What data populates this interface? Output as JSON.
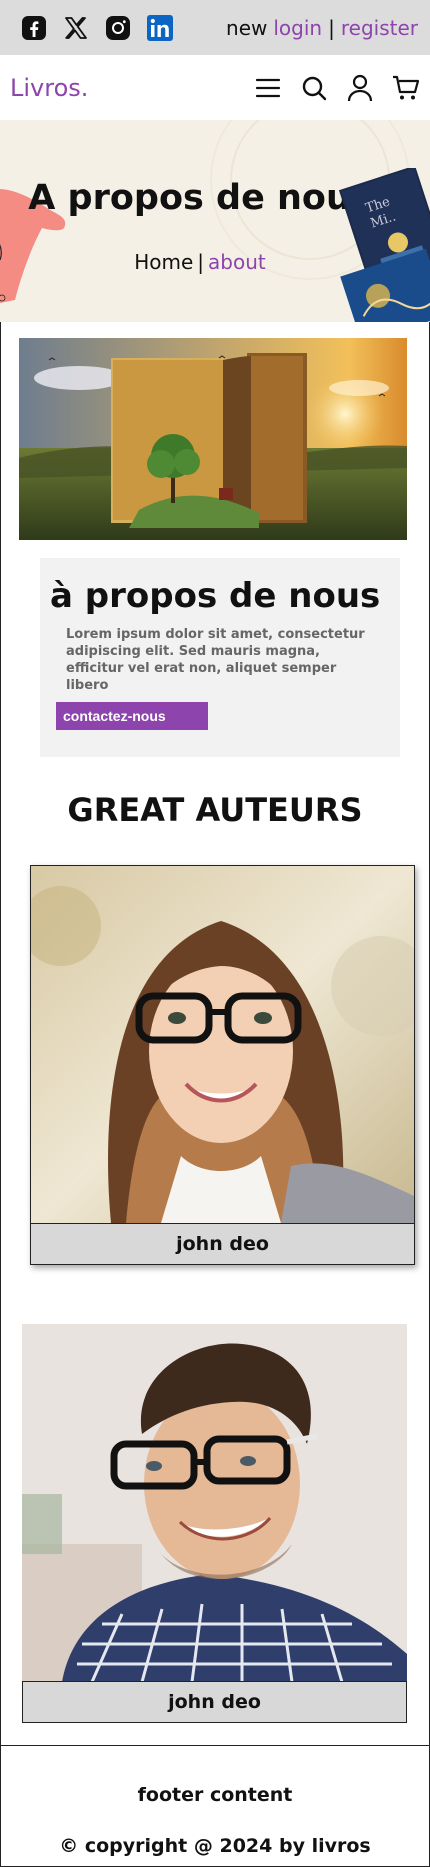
{
  "topbar": {
    "social": [
      "facebook-icon",
      "x-icon",
      "instagram-icon",
      "linkedin-icon"
    ],
    "new_label": "new",
    "login_label": "login",
    "separator": "|",
    "register_label": "register"
  },
  "header": {
    "logo": "Livros.",
    "icons": [
      "menu-icon",
      "search-icon",
      "user-icon",
      "cart-icon"
    ]
  },
  "banner": {
    "title": "A propos de nous",
    "breadcrumb_home": "Home",
    "breadcrumb_separator": "|",
    "breadcrumb_current": "about"
  },
  "about": {
    "title": "à propos de nous",
    "text": "Lorem ipsum dolor sit amet, consectetur adipiscing elit. Sed mauris magna, efficitur vel erat non, aliquet semper libero",
    "button_label": "contactez-nous"
  },
  "authors": {
    "title": "GREAT AUTEURS",
    "items": [
      {
        "name": "john deo"
      },
      {
        "name": "john deo"
      }
    ]
  },
  "footer": {
    "content": "footer content",
    "copyright": "© copyright @ 2024 by livros"
  },
  "colors": {
    "accent": "#8e44ad",
    "topbar_bg": "#dcdcdc",
    "banner_bg": "#f4f0e6"
  }
}
